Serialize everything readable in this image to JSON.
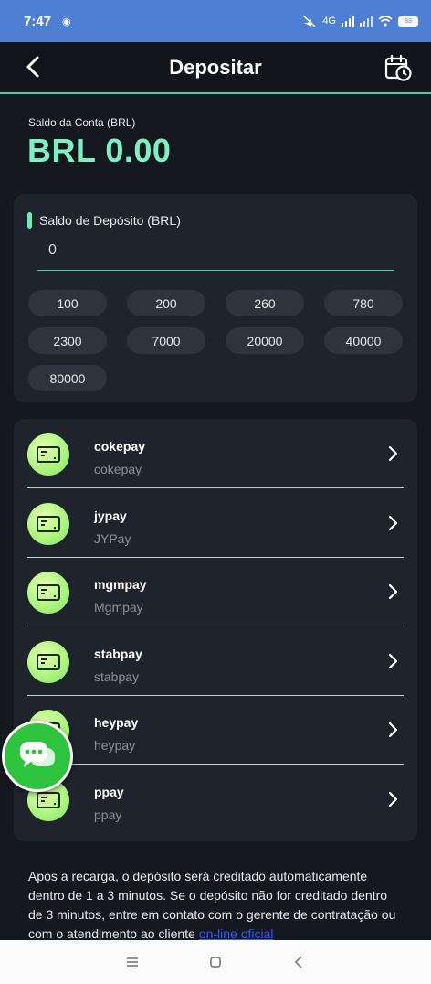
{
  "status_bar": {
    "time": "7:47",
    "network": "4G",
    "battery": "83"
  },
  "header": {
    "title": "Depositar"
  },
  "account": {
    "label": "Saldo da Conta (BRL)",
    "value": "BRL 0.00"
  },
  "deposit": {
    "label": "Saldo de Depósito (BRL)",
    "amount": "0",
    "presets": [
      "100",
      "200",
      "260",
      "780",
      "2300",
      "7000",
      "20000",
      "40000",
      "80000"
    ]
  },
  "payment_methods": [
    {
      "name": "cokepay",
      "sub": "cokepay"
    },
    {
      "name": "jypay",
      "sub": "JYPay"
    },
    {
      "name": "mgmpay",
      "sub": "Mgmpay"
    },
    {
      "name": "stabpay",
      "sub": "stabpay"
    },
    {
      "name": "heypay",
      "sub": "heypay"
    },
    {
      "name": "ppay",
      "sub": "ppay"
    }
  ],
  "notice": {
    "text": "Após a recarga, o depósito será creditado automaticamente dentro de 1 a 3 minutos. Se o depósito não for creditado dentro de 3 minutos, entre em contato com o gerente de contratação ou com o atendimento ao cliente ",
    "link": "on-line oficial"
  },
  "icons": {
    "back": "chevron-left-icon",
    "history": "calendar-clock-icon",
    "chat": "chat-bubble-icon",
    "card": "credit-card-icon"
  },
  "colors": {
    "accent": "#64f0b5",
    "balance": "#7ef0c1",
    "status_bar": "#4f7fd2",
    "chat": "#2ec440"
  }
}
